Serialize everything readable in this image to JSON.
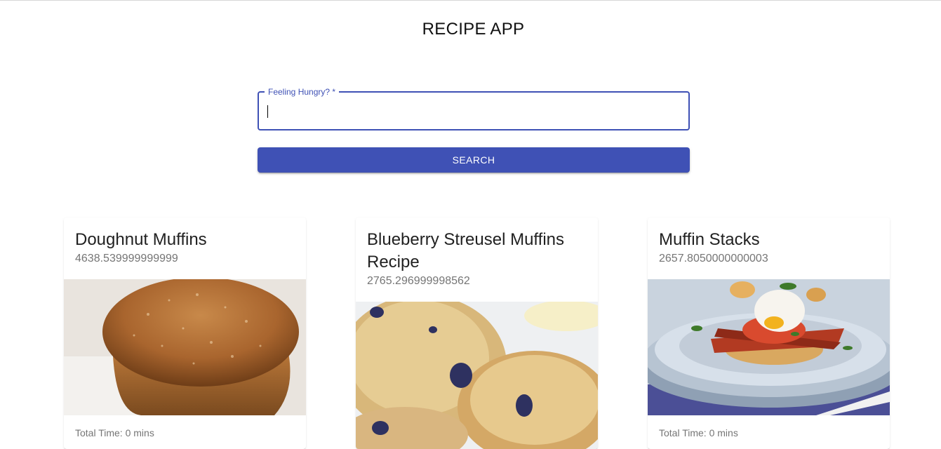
{
  "app": {
    "title": "RECIPE APP"
  },
  "search": {
    "label": "Feeling Hungry? *",
    "value": "",
    "button_label": "SEARCH"
  },
  "recipes": [
    {
      "title": "Doughnut Muffins",
      "calories": "4638.539999999999",
      "image_icon": "doughnut-muffin-photo",
      "total_time": "Total Time: 0 mins"
    },
    {
      "title": "Blueberry Streusel Muffins Recipe",
      "calories": "2765.296999998562",
      "image_icon": "blueberry-muffin-photo",
      "total_time": ""
    },
    {
      "title": "Muffin Stacks",
      "calories": "2657.8050000000003",
      "image_icon": "muffin-stack-photo",
      "total_time": "Total Time: 0 mins"
    }
  ],
  "colors": {
    "primary": "#3f51b5",
    "subtext": "#757575"
  }
}
